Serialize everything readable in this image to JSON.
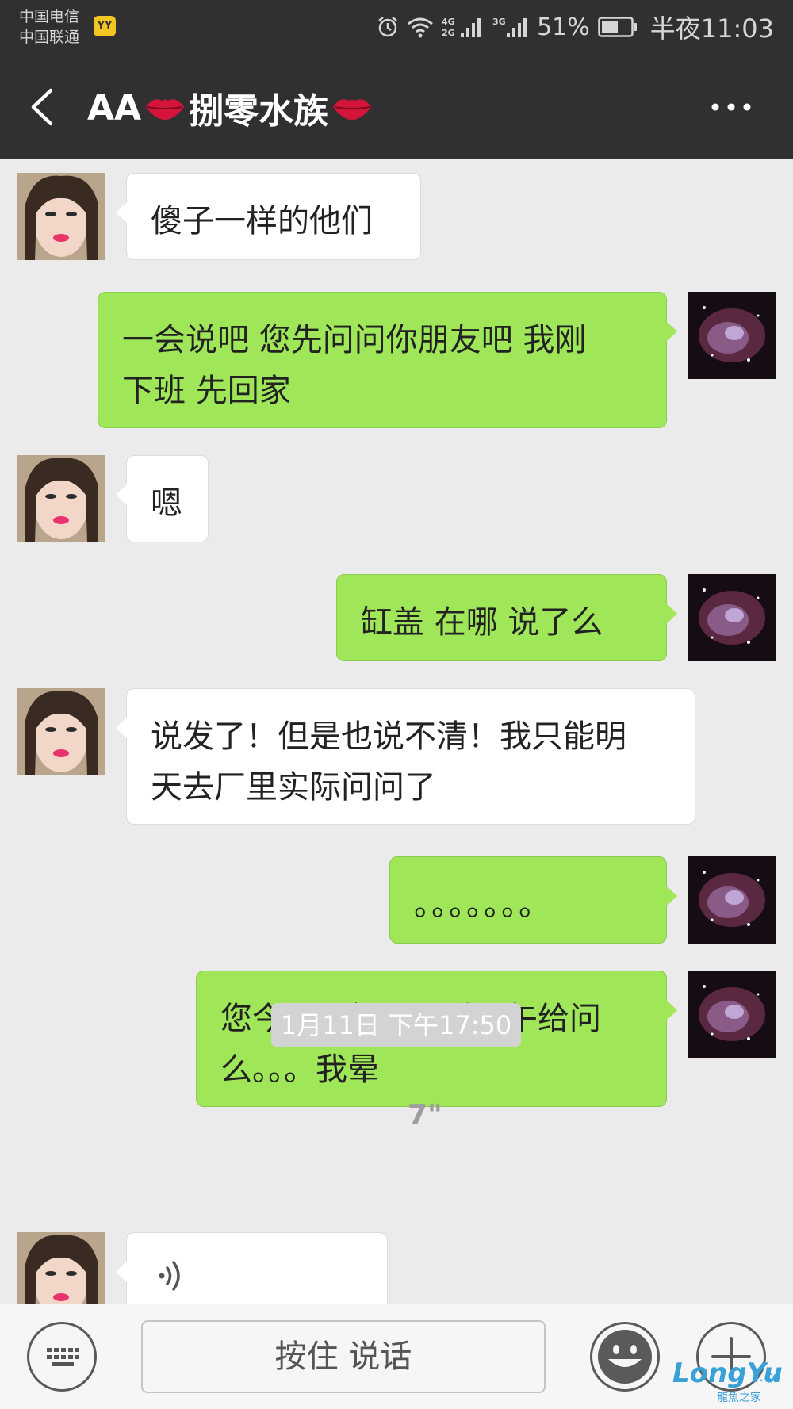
{
  "status_bar": {
    "carrier_1": "中国电信",
    "carrier_2": "中国联通",
    "app_badge": "YY",
    "signal_label_1": "4G",
    "signal_label_2": "2G",
    "signal_label_3": "3G",
    "battery": "51%",
    "time": "半夜11:03"
  },
  "header": {
    "title_prefix": "AA",
    "title_main": "捌零水族",
    "title_icon": "kiss-lips-icon"
  },
  "messages": [
    {
      "side": "in",
      "text": "傻子一样的他们"
    },
    {
      "side": "out",
      "line1": "一会说吧  您先问问你朋友吧   我刚",
      "line2": "下班  先回家"
    },
    {
      "side": "in",
      "text": "嗯"
    },
    {
      "side": "out",
      "text": "缸盖  在哪  说了么"
    },
    {
      "side": "in",
      "line1": "说发了！但是也说不清！我只能明",
      "line2": "天去厂里实际问问了"
    },
    {
      "side": "out",
      "text": "。。。。。。。"
    },
    {
      "side": "out",
      "line1": "您今天上午不是说下午给问",
      "line2": "么。。。我晕"
    }
  ],
  "timestamp": "1月11日 下午17:50",
  "voice_message": {
    "duration": "7\""
  },
  "input_bar": {
    "hold_to_talk": "按住 说话"
  },
  "watermark": {
    "main": "LongYu",
    "cc": ".cc",
    "sub": "龍魚之家"
  },
  "colors": {
    "header_bg": "#303030",
    "chat_bg": "#ebebeb",
    "outgoing_bubble": "#9fe658",
    "incoming_bubble": "#ffffff"
  }
}
